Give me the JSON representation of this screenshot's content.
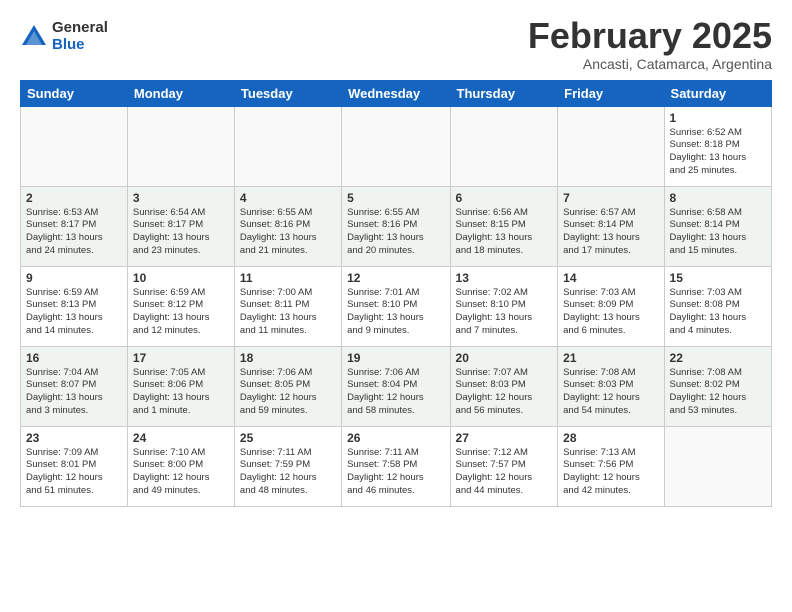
{
  "header": {
    "logo_general": "General",
    "logo_blue": "Blue",
    "month_title": "February 2025",
    "subtitle": "Ancasti, Catamarca, Argentina"
  },
  "weekdays": [
    "Sunday",
    "Monday",
    "Tuesday",
    "Wednesday",
    "Thursday",
    "Friday",
    "Saturday"
  ],
  "weeks": [
    [
      {
        "day": "",
        "info": ""
      },
      {
        "day": "",
        "info": ""
      },
      {
        "day": "",
        "info": ""
      },
      {
        "day": "",
        "info": ""
      },
      {
        "day": "",
        "info": ""
      },
      {
        "day": "",
        "info": ""
      },
      {
        "day": "1",
        "info": "Sunrise: 6:52 AM\nSunset: 8:18 PM\nDaylight: 13 hours\nand 25 minutes."
      }
    ],
    [
      {
        "day": "2",
        "info": "Sunrise: 6:53 AM\nSunset: 8:17 PM\nDaylight: 13 hours\nand 24 minutes."
      },
      {
        "day": "3",
        "info": "Sunrise: 6:54 AM\nSunset: 8:17 PM\nDaylight: 13 hours\nand 23 minutes."
      },
      {
        "day": "4",
        "info": "Sunrise: 6:55 AM\nSunset: 8:16 PM\nDaylight: 13 hours\nand 21 minutes."
      },
      {
        "day": "5",
        "info": "Sunrise: 6:55 AM\nSunset: 8:16 PM\nDaylight: 13 hours\nand 20 minutes."
      },
      {
        "day": "6",
        "info": "Sunrise: 6:56 AM\nSunset: 8:15 PM\nDaylight: 13 hours\nand 18 minutes."
      },
      {
        "day": "7",
        "info": "Sunrise: 6:57 AM\nSunset: 8:14 PM\nDaylight: 13 hours\nand 17 minutes."
      },
      {
        "day": "8",
        "info": "Sunrise: 6:58 AM\nSunset: 8:14 PM\nDaylight: 13 hours\nand 15 minutes."
      }
    ],
    [
      {
        "day": "9",
        "info": "Sunrise: 6:59 AM\nSunset: 8:13 PM\nDaylight: 13 hours\nand 14 minutes."
      },
      {
        "day": "10",
        "info": "Sunrise: 6:59 AM\nSunset: 8:12 PM\nDaylight: 13 hours\nand 12 minutes."
      },
      {
        "day": "11",
        "info": "Sunrise: 7:00 AM\nSunset: 8:11 PM\nDaylight: 13 hours\nand 11 minutes."
      },
      {
        "day": "12",
        "info": "Sunrise: 7:01 AM\nSunset: 8:10 PM\nDaylight: 13 hours\nand 9 minutes."
      },
      {
        "day": "13",
        "info": "Sunrise: 7:02 AM\nSunset: 8:10 PM\nDaylight: 13 hours\nand 7 minutes."
      },
      {
        "day": "14",
        "info": "Sunrise: 7:03 AM\nSunset: 8:09 PM\nDaylight: 13 hours\nand 6 minutes."
      },
      {
        "day": "15",
        "info": "Sunrise: 7:03 AM\nSunset: 8:08 PM\nDaylight: 13 hours\nand 4 minutes."
      }
    ],
    [
      {
        "day": "16",
        "info": "Sunrise: 7:04 AM\nSunset: 8:07 PM\nDaylight: 13 hours\nand 3 minutes."
      },
      {
        "day": "17",
        "info": "Sunrise: 7:05 AM\nSunset: 8:06 PM\nDaylight: 13 hours\nand 1 minute."
      },
      {
        "day": "18",
        "info": "Sunrise: 7:06 AM\nSunset: 8:05 PM\nDaylight: 12 hours\nand 59 minutes."
      },
      {
        "day": "19",
        "info": "Sunrise: 7:06 AM\nSunset: 8:04 PM\nDaylight: 12 hours\nand 58 minutes."
      },
      {
        "day": "20",
        "info": "Sunrise: 7:07 AM\nSunset: 8:03 PM\nDaylight: 12 hours\nand 56 minutes."
      },
      {
        "day": "21",
        "info": "Sunrise: 7:08 AM\nSunset: 8:03 PM\nDaylight: 12 hours\nand 54 minutes."
      },
      {
        "day": "22",
        "info": "Sunrise: 7:08 AM\nSunset: 8:02 PM\nDaylight: 12 hours\nand 53 minutes."
      }
    ],
    [
      {
        "day": "23",
        "info": "Sunrise: 7:09 AM\nSunset: 8:01 PM\nDaylight: 12 hours\nand 51 minutes."
      },
      {
        "day": "24",
        "info": "Sunrise: 7:10 AM\nSunset: 8:00 PM\nDaylight: 12 hours\nand 49 minutes."
      },
      {
        "day": "25",
        "info": "Sunrise: 7:11 AM\nSunset: 7:59 PM\nDaylight: 12 hours\nand 48 minutes."
      },
      {
        "day": "26",
        "info": "Sunrise: 7:11 AM\nSunset: 7:58 PM\nDaylight: 12 hours\nand 46 minutes."
      },
      {
        "day": "27",
        "info": "Sunrise: 7:12 AM\nSunset: 7:57 PM\nDaylight: 12 hours\nand 44 minutes."
      },
      {
        "day": "28",
        "info": "Sunrise: 7:13 AM\nSunset: 7:56 PM\nDaylight: 12 hours\nand 42 minutes."
      },
      {
        "day": "",
        "info": ""
      }
    ]
  ]
}
